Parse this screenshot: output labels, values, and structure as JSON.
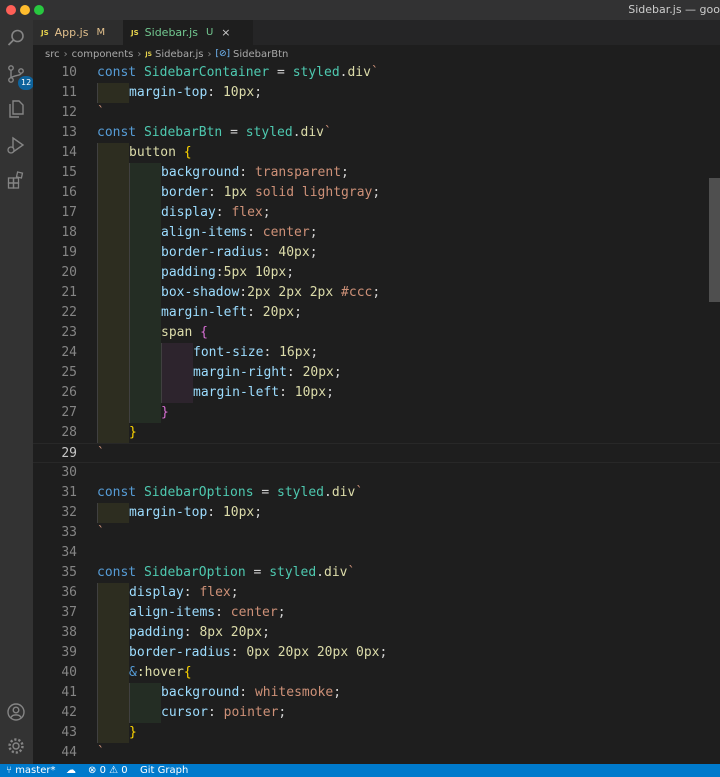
{
  "window": {
    "title": "Sidebar.js — goo"
  },
  "activity_bar": {
    "source_control_badge": "12"
  },
  "tabs": [
    {
      "icon": "JS",
      "label": "App.js",
      "status": "M"
    },
    {
      "icon": "JS",
      "label": "Sidebar.js",
      "status": "U",
      "close": "×"
    }
  ],
  "breadcrumb": [
    "src",
    "components",
    "Sidebar.js",
    "SidebarBtn"
  ],
  "breadcrumb_icons": {
    "file": "JS",
    "symbol": "[⊘]"
  },
  "editor": {
    "current_line": 29,
    "lines": [
      {
        "n": "10",
        "indent": [],
        "tokens": [
          {
            "t": "const ",
            "c": "k"
          },
          {
            "t": "SidebarContainer",
            "c": "c"
          },
          {
            "t": " = "
          },
          {
            "t": "styled",
            "c": "c"
          },
          {
            "t": "."
          },
          {
            "t": "div",
            "c": "f"
          },
          {
            "t": "`",
            "c": "s"
          }
        ]
      },
      {
        "n": "11",
        "indent": [
          1
        ],
        "tokens": [
          {
            "t": "margin-top",
            "c": "p"
          },
          {
            "t": ": "
          },
          {
            "t": "10px",
            "c": "f"
          },
          {
            "t": ";"
          }
        ]
      },
      {
        "n": "12",
        "indent": [],
        "tokens": [
          {
            "t": "`",
            "c": "s"
          }
        ]
      },
      {
        "n": "13",
        "indent": [],
        "tokens": [
          {
            "t": "const ",
            "c": "k"
          },
          {
            "t": "SidebarBtn",
            "c": "c"
          },
          {
            "t": " = "
          },
          {
            "t": "styled",
            "c": "c"
          },
          {
            "t": "."
          },
          {
            "t": "div",
            "c": "f"
          },
          {
            "t": "`",
            "c": "s"
          }
        ]
      },
      {
        "n": "14",
        "indent": [
          1
        ],
        "tokens": [
          {
            "t": "button",
            "c": "f"
          },
          {
            "t": " "
          },
          {
            "t": "{",
            "c": "y"
          }
        ]
      },
      {
        "n": "15",
        "indent": [
          1,
          2
        ],
        "tokens": [
          {
            "t": "background",
            "c": "p"
          },
          {
            "t": ": "
          },
          {
            "t": "transparent",
            "c": "s"
          },
          {
            "t": ";"
          }
        ]
      },
      {
        "n": "16",
        "indent": [
          1,
          2
        ],
        "tokens": [
          {
            "t": "border",
            "c": "p"
          },
          {
            "t": ": "
          },
          {
            "t": "1px",
            "c": "f"
          },
          {
            "t": " "
          },
          {
            "t": "solid",
            "c": "s"
          },
          {
            "t": " "
          },
          {
            "t": "lightgray",
            "c": "s"
          },
          {
            "t": ";"
          }
        ]
      },
      {
        "n": "17",
        "indent": [
          1,
          2
        ],
        "tokens": [
          {
            "t": "display",
            "c": "p"
          },
          {
            "t": ": "
          },
          {
            "t": "flex",
            "c": "s"
          },
          {
            "t": ";"
          }
        ]
      },
      {
        "n": "18",
        "indent": [
          1,
          2
        ],
        "tokens": [
          {
            "t": "align-items",
            "c": "p"
          },
          {
            "t": ": "
          },
          {
            "t": "center",
            "c": "s"
          },
          {
            "t": ";"
          }
        ]
      },
      {
        "n": "19",
        "indent": [
          1,
          2
        ],
        "tokens": [
          {
            "t": "border-radius",
            "c": "p"
          },
          {
            "t": ": "
          },
          {
            "t": "40px",
            "c": "f"
          },
          {
            "t": ";"
          }
        ]
      },
      {
        "n": "20",
        "indent": [
          1,
          2
        ],
        "tokens": [
          {
            "t": "padding",
            "c": "p"
          },
          {
            "t": ":"
          },
          {
            "t": "5px",
            "c": "f"
          },
          {
            "t": " "
          },
          {
            "t": "10px",
            "c": "f"
          },
          {
            "t": ";"
          }
        ]
      },
      {
        "n": "21",
        "indent": [
          1,
          2
        ],
        "tokens": [
          {
            "t": "box-shadow",
            "c": "p"
          },
          {
            "t": ":"
          },
          {
            "t": "2px",
            "c": "f"
          },
          {
            "t": " "
          },
          {
            "t": "2px",
            "c": "f"
          },
          {
            "t": " "
          },
          {
            "t": "2px",
            "c": "f"
          },
          {
            "t": " "
          },
          {
            "t": "#ccc",
            "c": "s"
          },
          {
            "t": ";"
          }
        ]
      },
      {
        "n": "22",
        "indent": [
          1,
          2
        ],
        "tokens": [
          {
            "t": "margin-left",
            "c": "p"
          },
          {
            "t": ": "
          },
          {
            "t": "20px",
            "c": "f"
          },
          {
            "t": ";"
          }
        ]
      },
      {
        "n": "23",
        "indent": [
          1,
          2
        ],
        "tokens": [
          {
            "t": "span",
            "c": "f"
          },
          {
            "t": " "
          },
          {
            "t": "{",
            "c": "m"
          }
        ]
      },
      {
        "n": "24",
        "indent": [
          1,
          2,
          3
        ],
        "tokens": [
          {
            "t": "font-size",
            "c": "p"
          },
          {
            "t": ": "
          },
          {
            "t": "16px",
            "c": "f"
          },
          {
            "t": ";"
          }
        ]
      },
      {
        "n": "25",
        "indent": [
          1,
          2,
          3
        ],
        "tokens": [
          {
            "t": "margin-right",
            "c": "p"
          },
          {
            "t": ": "
          },
          {
            "t": "20px",
            "c": "f"
          },
          {
            "t": ";"
          }
        ]
      },
      {
        "n": "26",
        "indent": [
          1,
          2,
          3
        ],
        "tokens": [
          {
            "t": "margin-left",
            "c": "p"
          },
          {
            "t": ": "
          },
          {
            "t": "10px",
            "c": "f"
          },
          {
            "t": ";"
          }
        ]
      },
      {
        "n": "27",
        "indent": [
          1,
          2
        ],
        "tokens": [
          {
            "t": "}",
            "c": "m"
          }
        ]
      },
      {
        "n": "28",
        "indent": [
          1
        ],
        "tokens": [
          {
            "t": "}",
            "c": "y"
          }
        ]
      },
      {
        "n": "29",
        "indent": [],
        "tokens": [
          {
            "t": "`",
            "c": "s"
          }
        ]
      },
      {
        "n": "30",
        "indent": [],
        "tokens": []
      },
      {
        "n": "31",
        "indent": [],
        "tokens": [
          {
            "t": "const ",
            "c": "k"
          },
          {
            "t": "SidebarOptions",
            "c": "c"
          },
          {
            "t": " = "
          },
          {
            "t": "styled",
            "c": "c"
          },
          {
            "t": "."
          },
          {
            "t": "div",
            "c": "f"
          },
          {
            "t": "`",
            "c": "s"
          }
        ]
      },
      {
        "n": "32",
        "indent": [
          1
        ],
        "tokens": [
          {
            "t": "margin-top",
            "c": "p"
          },
          {
            "t": ": "
          },
          {
            "t": "10px",
            "c": "f"
          },
          {
            "t": ";"
          }
        ]
      },
      {
        "n": "33",
        "indent": [],
        "tokens": [
          {
            "t": "`",
            "c": "s"
          }
        ]
      },
      {
        "n": "34",
        "indent": [],
        "tokens": []
      },
      {
        "n": "35",
        "indent": [],
        "tokens": [
          {
            "t": "const ",
            "c": "k"
          },
          {
            "t": "SidebarOption",
            "c": "c"
          },
          {
            "t": " = "
          },
          {
            "t": "styled",
            "c": "c"
          },
          {
            "t": "."
          },
          {
            "t": "div",
            "c": "f"
          },
          {
            "t": "`",
            "c": "s"
          }
        ]
      },
      {
        "n": "36",
        "indent": [
          1
        ],
        "tokens": [
          {
            "t": "display",
            "c": "p"
          },
          {
            "t": ": "
          },
          {
            "t": "flex",
            "c": "s"
          },
          {
            "t": ";"
          }
        ]
      },
      {
        "n": "37",
        "indent": [
          1
        ],
        "tokens": [
          {
            "t": "align-items",
            "c": "p"
          },
          {
            "t": ": "
          },
          {
            "t": "center",
            "c": "s"
          },
          {
            "t": ";"
          }
        ]
      },
      {
        "n": "38",
        "indent": [
          1
        ],
        "tokens": [
          {
            "t": "padding",
            "c": "p"
          },
          {
            "t": ": "
          },
          {
            "t": "8px",
            "c": "f"
          },
          {
            "t": " "
          },
          {
            "t": "20px",
            "c": "f"
          },
          {
            "t": ";"
          }
        ]
      },
      {
        "n": "39",
        "indent": [
          1
        ],
        "tokens": [
          {
            "t": "border-radius",
            "c": "p"
          },
          {
            "t": ": "
          },
          {
            "t": "0px",
            "c": "f"
          },
          {
            "t": " "
          },
          {
            "t": "20px",
            "c": "f"
          },
          {
            "t": " "
          },
          {
            "t": "20px",
            "c": "f"
          },
          {
            "t": " "
          },
          {
            "t": "0px",
            "c": "f"
          },
          {
            "t": ";"
          }
        ]
      },
      {
        "n": "40",
        "indent": [
          1
        ],
        "tokens": [
          {
            "t": "&",
            "c": "k"
          },
          {
            "t": ":hover",
            "c": "f"
          },
          {
            "t": "{",
            "c": "y"
          }
        ]
      },
      {
        "n": "41",
        "indent": [
          1,
          2
        ],
        "tokens": [
          {
            "t": "background",
            "c": "p"
          },
          {
            "t": ": "
          },
          {
            "t": "whitesmoke",
            "c": "s"
          },
          {
            "t": ";"
          }
        ]
      },
      {
        "n": "42",
        "indent": [
          1,
          2
        ],
        "tokens": [
          {
            "t": "cursor",
            "c": "p"
          },
          {
            "t": ": "
          },
          {
            "t": "pointer",
            "c": "s"
          },
          {
            "t": ";"
          }
        ]
      },
      {
        "n": "43",
        "indent": [
          1
        ],
        "tokens": [
          {
            "t": "}",
            "c": "y"
          }
        ]
      },
      {
        "n": "44",
        "indent": [],
        "tokens": [
          {
            "t": "`",
            "c": "s"
          }
        ]
      }
    ]
  },
  "status_bar": {
    "branch": "master*",
    "errors": "0",
    "warnings": "0",
    "extension": "Git Graph"
  }
}
